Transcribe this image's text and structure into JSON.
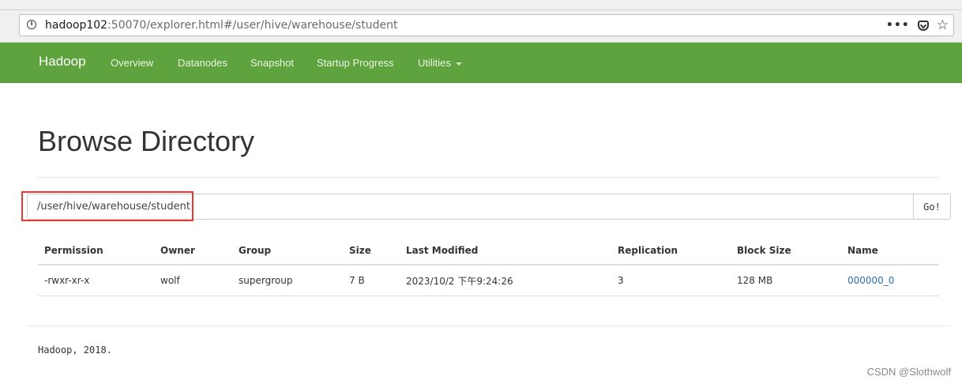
{
  "browser": {
    "url_host": "hadoop102",
    "url_rest": ":50070/explorer.html#/user/hive/warehouse/student",
    "actions": [
      "more-icon",
      "pocket-icon",
      "bookmark-star-icon"
    ]
  },
  "navbar": {
    "brand": "Hadoop",
    "items": [
      "Overview",
      "Datanodes",
      "Snapshot",
      "Startup Progress",
      "Utilities"
    ],
    "color": "#5fa33e"
  },
  "main": {
    "title": "Browse Directory",
    "path_value": "/user/hive/warehouse/student",
    "go_label": "Go!"
  },
  "table": {
    "headers": [
      "Permission",
      "Owner",
      "Group",
      "Size",
      "Last Modified",
      "Replication",
      "Block Size",
      "Name"
    ],
    "rows": [
      [
        "-rwxr-xr-x",
        "wolf",
        "supergroup",
        "7 B",
        "2023/10/2 下午9:24:26",
        "3",
        "128 MB",
        "000000_0"
      ]
    ]
  },
  "footer": {
    "text": "Hadoop, 2018."
  },
  "watermark": "CSDN @Slothwolf"
}
